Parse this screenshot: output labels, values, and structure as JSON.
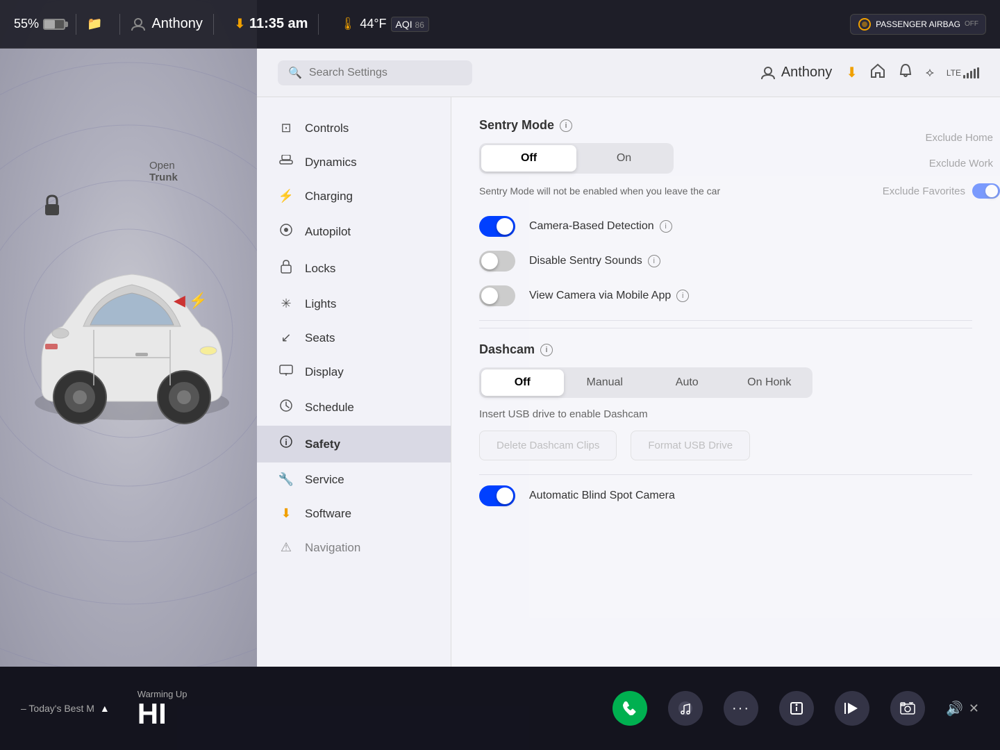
{
  "statusBar": {
    "battery": "55%",
    "user": "Anthony",
    "time": "11:35 am",
    "temperature": "44°F",
    "aqi_label": "AQI",
    "aqi_value": "86",
    "passenger_airbag": "PASSENGER AIRBAG"
  },
  "settingsHeader": {
    "search_placeholder": "Search Settings",
    "username": "Anthony",
    "lte_label": "LTE"
  },
  "nav": {
    "items": [
      {
        "id": "controls",
        "label": "Controls",
        "icon": "⊡"
      },
      {
        "id": "dynamics",
        "label": "Dynamics",
        "icon": "🚗"
      },
      {
        "id": "charging",
        "label": "Charging",
        "icon": "⚡"
      },
      {
        "id": "autopilot",
        "label": "Autopilot",
        "icon": "⊙"
      },
      {
        "id": "locks",
        "label": "Locks",
        "icon": "🔒"
      },
      {
        "id": "lights",
        "label": "Lights",
        "icon": "✳"
      },
      {
        "id": "seats",
        "label": "Seats",
        "icon": "↙"
      },
      {
        "id": "display",
        "label": "Display",
        "icon": "⬜"
      },
      {
        "id": "schedule",
        "label": "Schedule",
        "icon": "⊙"
      },
      {
        "id": "safety",
        "label": "Safety",
        "icon": "ⓘ"
      },
      {
        "id": "service",
        "label": "Service",
        "icon": "🔧"
      },
      {
        "id": "software",
        "label": "Software",
        "icon": "⬇"
      },
      {
        "id": "navigation",
        "label": "Navigation",
        "icon": "⚠"
      }
    ]
  },
  "safetySettings": {
    "sentry_mode_title": "Sentry Mode",
    "sentry_off_label": "Off",
    "sentry_on_label": "On",
    "sentry_description": "Sentry Mode will not be enabled when you leave the car",
    "camera_detection_label": "Camera-Based Detection",
    "disable_sounds_label": "Disable Sentry Sounds",
    "view_camera_label": "View Camera via Mobile App",
    "exclude_home": "Exclude Home",
    "exclude_work": "Exclude Work",
    "exclude_favorites": "Exclude Favorites",
    "dashcam_title": "Dashcam",
    "dashcam_off": "Off",
    "dashcam_manual": "Manual",
    "dashcam_auto": "Auto",
    "dashcam_on_honk": "On Honk",
    "usb_message": "Insert USB drive to enable Dashcam",
    "delete_clips_label": "Delete Dashcam Clips",
    "format_usb_label": "Format USB Drive",
    "blind_spot_label": "Automatic Blind Spot Camera"
  },
  "car": {
    "open_trunk_line1": "Open",
    "open_trunk_line2": "Trunk"
  },
  "taskbar": {
    "media_label": "– Today's Best M",
    "temp_label": "Warming Up",
    "hi_label": "HI",
    "volume_icon": "🔊"
  }
}
